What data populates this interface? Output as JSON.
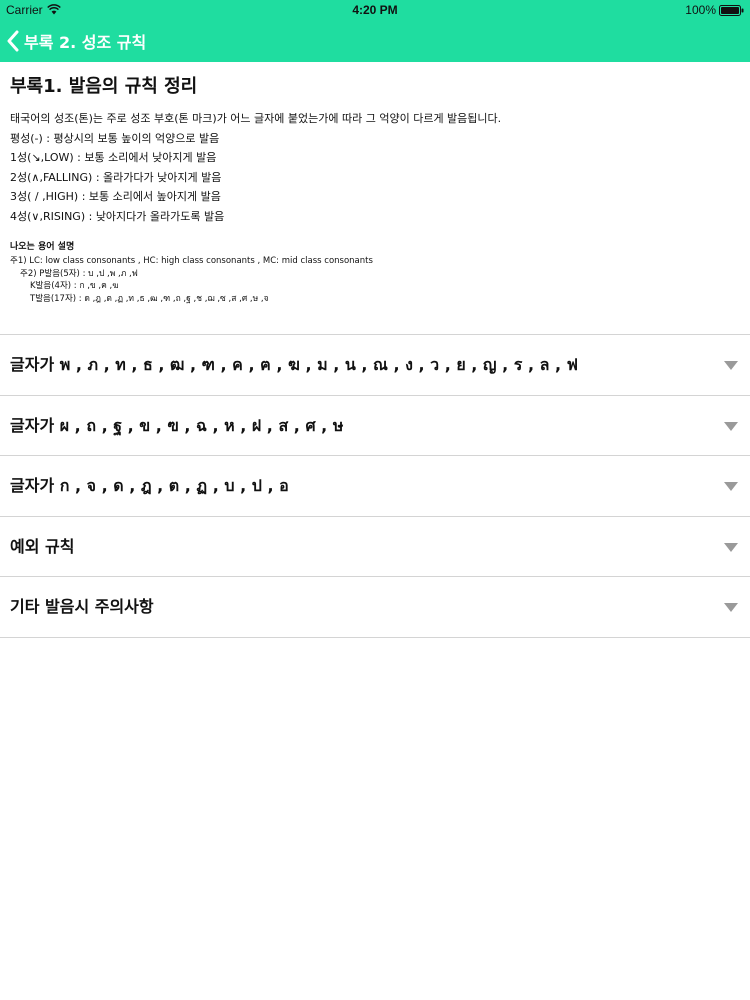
{
  "status_bar": {
    "carrier": "Carrier",
    "time": "4:20 PM",
    "battery": "100%"
  },
  "nav": {
    "back_label": "부록 2. 성조 규칙",
    "back_icon": "chevron-left-icon",
    "accent_color": "#1fdda0"
  },
  "intro": {
    "title": "부록1. 발음의 규칙 정리",
    "lines": [
      "태국어의 성조(톤)는 주로 성조 부호(톤 마크)가 어느 글자에 붙었는가에 따라 그 억양이 다르게 발음됩니다.",
      "평성(-) : 평상시의 보통 높이의 억양으로 발음",
      "1성(↘,LOW) : 보통 소리에서 낮아지게 발음",
      "2성(∧,FALLING) : 올라가다가 낮아지게 발음",
      "3성( / ,HIGH) : 보통 소리에서 높아지게 발음",
      "4성(∨,RISING) : 낮아지다가 올라가도록 발음"
    ],
    "notes_title": "나오는 용어 설명",
    "notes": [
      "주1) LC: low class consonants , HC: high class consonants , MC: mid class consonants",
      "주2) P발음(5자) : บ ,ป ,พ ,ภ ,ฟ",
      "K발음(4자) : ก ,ข ,ค ,ฆ",
      "T발음(17자) : ด ,ฎ ,ต ,ฏ ,ท ,ธ ,ฒ ,ฑ ,ถ ,ฐ ,ช ,ฌ ,ซ ,ส ,ศ ,ษ ,จ"
    ]
  },
  "sections": [
    {
      "label": "글자가 พ , ภ , ท , ธ , ฒ , ฑ , ค , ฅ , ฆ , ม , น , ณ , ง , ว , ย , ญ , ร , ล , ฟ",
      "icon": "chevron-down-icon"
    },
    {
      "label": "글자가 ผ , ถ , ฐ , ข , ฃ , ฉ , ห , ฝ , ส , ศ , ษ",
      "icon": "chevron-down-icon"
    },
    {
      "label": "글자가 ก , จ , ด , ฎ , ต , ฏ , บ , ป , อ",
      "icon": "chevron-down-icon"
    },
    {
      "label": "예외 규칙",
      "icon": "chevron-down-icon"
    },
    {
      "label": "기타 발음시 주의사항",
      "icon": "chevron-down-icon"
    }
  ]
}
